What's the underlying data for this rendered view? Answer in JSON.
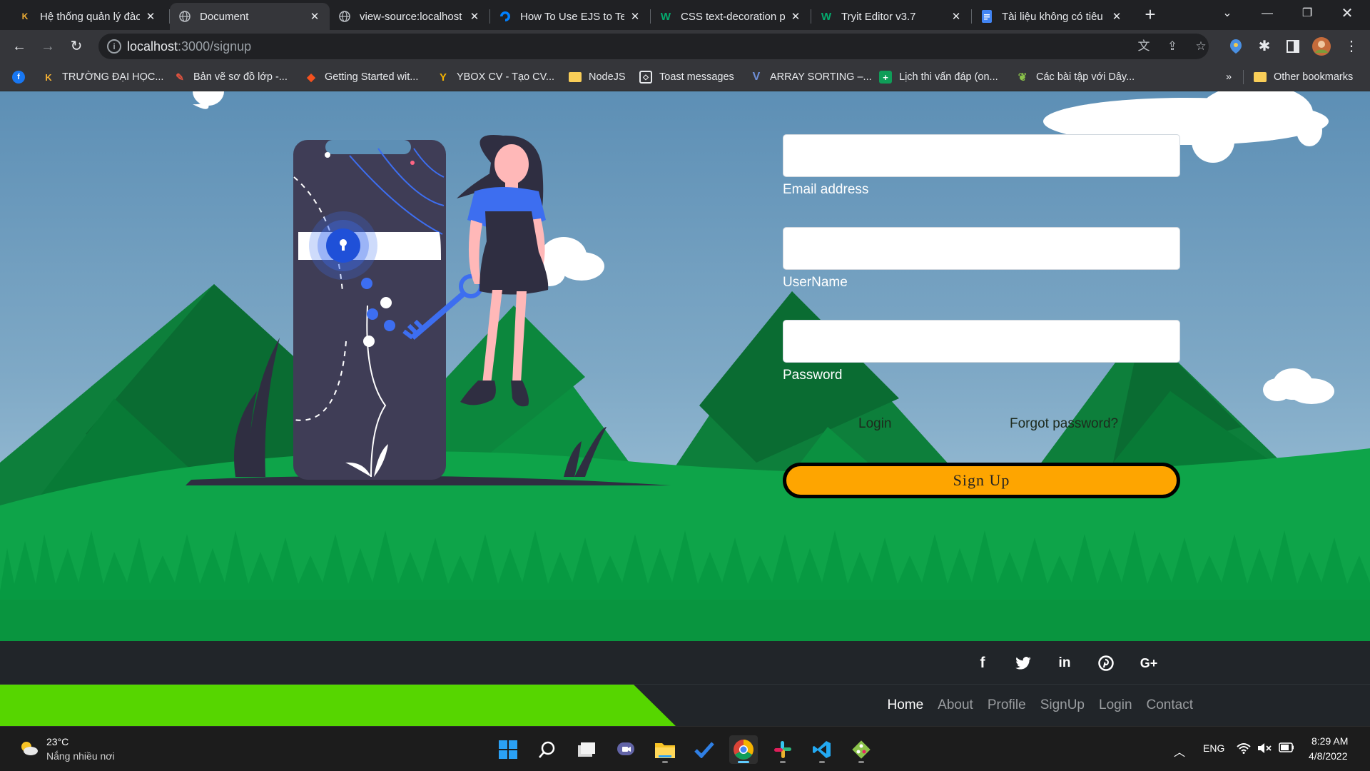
{
  "browser": {
    "tabs": [
      {
        "title": "Hệ thống quản lý đào",
        "favicon": "university-logo-icon",
        "active": false
      },
      {
        "title": "Document",
        "favicon": "globe-icon",
        "active": true
      },
      {
        "title": "view-source:localhost",
        "favicon": "globe-icon",
        "active": false
      },
      {
        "title": "How To Use EJS to Ter",
        "favicon": "digitalocean-icon",
        "active": false
      },
      {
        "title": "CSS text-decoration p",
        "favicon": "w3schools-icon",
        "active": false
      },
      {
        "title": "Tryit Editor v3.7",
        "favicon": "w3schools-icon",
        "active": false
      },
      {
        "title": "Tài liệu không có tiêu",
        "favicon": "google-docs-icon",
        "active": false
      }
    ],
    "url_host": "localhost",
    "url_path": ":3000/signup",
    "bookmarks": [
      {
        "label": "",
        "icon": "facebook-icon"
      },
      {
        "label": "TRƯỜNG ĐẠI HỌC...",
        "icon": "university-logo-icon"
      },
      {
        "label": "Bản vẽ sơ đồ lớp -...",
        "icon": "drawing-icon"
      },
      {
        "label": "Getting Started wit...",
        "icon": "laravel-icon"
      },
      {
        "label": "YBOX CV - Tạo CV...",
        "icon": "ybox-icon"
      },
      {
        "label": "NodeJS",
        "icon": "folder-icon"
      },
      {
        "label": "Toast messages",
        "icon": "codepen-icon"
      },
      {
        "label": "ARRAY SORTING –...",
        "icon": "v-icon"
      },
      {
        "label": "Lịch thi vấn đáp (on...",
        "icon": "google-sheets-icon"
      },
      {
        "label": "Các bài tập với Dây...",
        "icon": "leaf-icon"
      }
    ],
    "bookmarks_overflow": "»",
    "other_bookmarks": "Other bookmarks"
  },
  "form": {
    "email_label": "Email address",
    "email_value": "",
    "username_label": "UserName",
    "username_value": "",
    "password_label": "Password",
    "password_value": "",
    "login_link": "Login",
    "forgot_link": "Forgot password?",
    "signup_button": "Sign Up"
  },
  "footer": {
    "social": [
      {
        "name": "facebook-icon",
        "glyph": "f"
      },
      {
        "name": "twitter-icon",
        "glyph": "🐦"
      },
      {
        "name": "linkedin-icon",
        "glyph": "in"
      },
      {
        "name": "pinterest-icon",
        "glyph": "P"
      },
      {
        "name": "google-plus-icon",
        "glyph": "G+"
      }
    ],
    "nav": [
      {
        "label": "Home",
        "current": true
      },
      {
        "label": "About",
        "current": false
      },
      {
        "label": "Profile",
        "current": false
      },
      {
        "label": "SignUp",
        "current": false
      },
      {
        "label": "Login",
        "current": false
      },
      {
        "label": "Contact",
        "current": false
      }
    ]
  },
  "taskbar": {
    "temperature": "23°C",
    "weather": "Nắng nhiều nơi",
    "language": "ENG",
    "time": "8:29 AM",
    "date": "4/8/2022"
  },
  "colors": {
    "signup_button": "#fea500",
    "footer_accent": "#56d600",
    "footer_bg": "#212529",
    "grass": "#0aa046"
  }
}
